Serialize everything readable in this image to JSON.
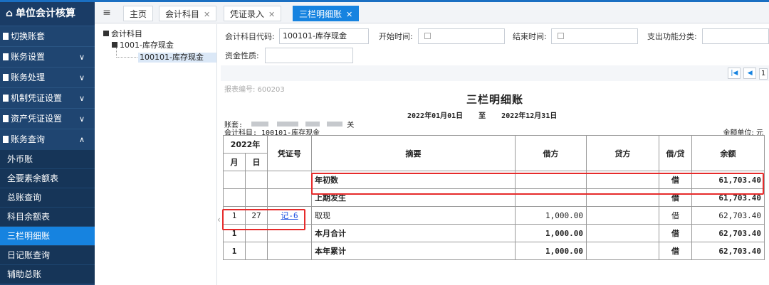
{
  "sidebar": {
    "brand": "单位会计核算",
    "menu": [
      {
        "label": "切换账套",
        "chevron": ""
      },
      {
        "label": "账务设置",
        "chevron": "∨"
      },
      {
        "label": "账务处理",
        "chevron": "∨"
      },
      {
        "label": "机制凭证设置",
        "chevron": "∨"
      },
      {
        "label": "资产凭证设置",
        "chevron": "∨"
      },
      {
        "label": "账务查询",
        "chevron": "∧"
      }
    ],
    "submenu": [
      "外币账",
      "全要素余额表",
      "总账查询",
      "科目余额表",
      "三栏明细账",
      "日记账查询",
      "辅助总账"
    ],
    "active_sub": "三栏明细账"
  },
  "tabs": [
    {
      "label": "主页",
      "closable": false
    },
    {
      "label": "会计科目",
      "closable": true
    },
    {
      "label": "凭证录入",
      "closable": true
    },
    {
      "label": "三栏明细账",
      "closable": true,
      "active": true
    }
  ],
  "tree": {
    "root": "会计科目",
    "child": "1001-库存现金",
    "leaf": "100101-库存现金"
  },
  "filters": {
    "code_label": "会计科目代码:",
    "code_value": "100101-库存现金",
    "start_label": "开始时间:",
    "end_label": "结束时间:",
    "func_label": "支出功能分类:",
    "nature_label": "资金性质:"
  },
  "pager": {
    "page": "1"
  },
  "report": {
    "report_no": "报表编号: 600203",
    "title": "三栏明细账",
    "date_from": "2022年01月01日",
    "date_to_word": "至",
    "date_to": "2022年12月31日",
    "book_label": "账套:",
    "book_suffix": "关",
    "subject": "会计科目: 100101-库存现金",
    "unit": "金额单位: 元",
    "headers": {
      "year": "2022年",
      "month": "月",
      "day": "日",
      "voucher": "凭证号",
      "summary": "摘要",
      "debit": "借方",
      "credit": "贷方",
      "dc": "借/贷",
      "balance": "余额"
    },
    "rows": [
      {
        "month": "",
        "day": "",
        "voucher": "",
        "summary": "年初数",
        "debit": "",
        "credit": "",
        "dc": "借",
        "balance": "61,703.40",
        "bold": true
      },
      {
        "month": "",
        "day": "",
        "voucher": "",
        "summary": "上期发生",
        "debit": "",
        "credit": "",
        "dc": "借",
        "balance": "61,703.40",
        "bold": true
      },
      {
        "month": "1",
        "day": "27",
        "voucher": "记-6",
        "summary": "取现",
        "debit": "1,000.00",
        "credit": "",
        "dc": "借",
        "balance": "62,703.40",
        "bold": false
      },
      {
        "month": "1",
        "day": "",
        "voucher": "",
        "summary": "本月合计",
        "debit": "1,000.00",
        "credit": "",
        "dc": "借",
        "balance": "62,703.40",
        "bold": true
      },
      {
        "month": "1",
        "day": "",
        "voucher": "",
        "summary": "本年累计",
        "debit": "1,000.00",
        "credit": "",
        "dc": "借",
        "balance": "62,703.40",
        "bold": true
      }
    ]
  },
  "colors": {
    "sidebar_bg": "#1f4571",
    "accent": "#1683e0",
    "highlight": "#e62b2b"
  }
}
